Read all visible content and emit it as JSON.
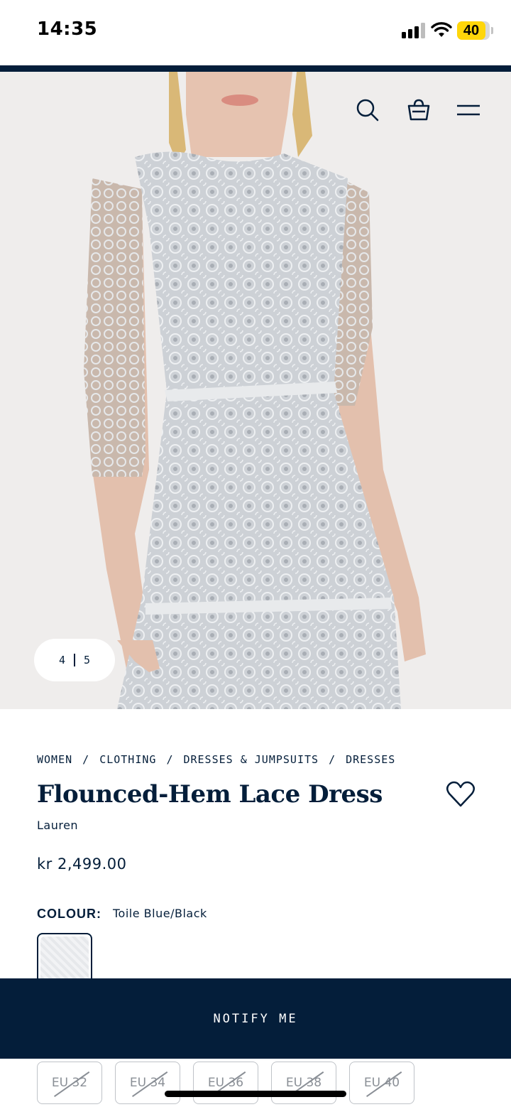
{
  "status_bar": {
    "time": "14:35",
    "battery": "40",
    "battery_color": "#ffd60a"
  },
  "header": {
    "icons": [
      "search-icon",
      "shopping-bag-icon",
      "menu-icon"
    ]
  },
  "gallery": {
    "current": "4",
    "total": "5",
    "image_alt": "Model wearing a light blue-grey lace dress"
  },
  "breadcrumb": [
    "WOMEN",
    "CLOTHING",
    "DRESSES & JUMPSUITS",
    "DRESSES"
  ],
  "product": {
    "title": "Flounced-Hem Lace Dress",
    "brand": "Lauren",
    "price": "kr 2,499.00",
    "colour_label": "COLOUR:",
    "colour_value": "Toile Blue/Black"
  },
  "sizes": [
    {
      "label": "EU 32",
      "available": false
    },
    {
      "label": "EU 34",
      "available": false
    },
    {
      "label": "EU 36",
      "available": false
    },
    {
      "label": "EU 38",
      "available": false
    },
    {
      "label": "EU 40",
      "available": false
    }
  ],
  "cta": {
    "notify_label": "NOTIFY ME"
  },
  "colors": {
    "navy": "#041e3a",
    "hero_background": "#efedec",
    "dress": "#cfd3d8"
  }
}
